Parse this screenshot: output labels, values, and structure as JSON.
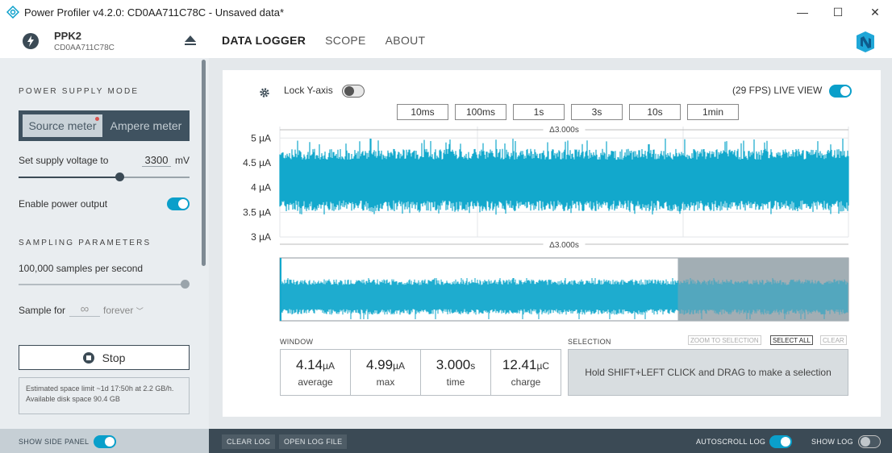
{
  "window": {
    "title": "Power Profiler v4.2.0: CD0AA711C78C - Unsaved data*",
    "minimize": "—",
    "maximize": "☐",
    "close": "✕"
  },
  "device": {
    "name": "PPK2",
    "serial": "CD0AA711C78C"
  },
  "nav": {
    "tabs": [
      "DATA LOGGER",
      "SCOPE",
      "ABOUT"
    ],
    "active": "DATA LOGGER"
  },
  "sidebar": {
    "power_supply_title": "POWER SUPPLY MODE",
    "source_meter": "Source meter",
    "ampere_meter": "Ampere meter",
    "voltage_label": "Set supply voltage to",
    "voltage_value": "3300",
    "voltage_unit": "mV",
    "voltage_fraction": 0.588,
    "power_output_label": "Enable power output",
    "power_output_enabled": true,
    "sampling_title": "SAMPLING PARAMETERS",
    "sample_rate_label": "100,000 samples per second",
    "sample_rate_fraction": 1.0,
    "sample_for_label": "Sample for",
    "sample_for_value": "∞",
    "sample_for_unit": "forever",
    "stop_label": "Stop",
    "space_info": "Estimated space limit ~1d 17:50h at 2.2 GB/h. Available disk space 90.4 GB"
  },
  "toolbar": {
    "lock_y_label": "Lock Y-axis",
    "lock_y_enabled": false,
    "live_view_label": "(29 FPS) LIVE VIEW",
    "live_view_enabled": true,
    "window_buttons": [
      "10ms",
      "100ms",
      "1s",
      "3s",
      "10s",
      "1min"
    ]
  },
  "chart_data": {
    "type": "line",
    "title": "",
    "xlabel": "",
    "ylabel": "",
    "y_unit": "µA",
    "yticks": [
      "5 µA",
      "4.5 µA",
      "4 µA",
      "3.5 µA",
      "3 µA"
    ],
    "ylim": [
      3,
      5.2
    ],
    "duration_label": "Δ3.000s",
    "band": {
      "mean": 4.14,
      "low_typical": 3.65,
      "high_typical": 4.65,
      "min_spike": 3.45,
      "max_spike": 4.99
    },
    "grid": true,
    "minimap_selection_fraction": [
      0.7,
      1.0
    ]
  },
  "window_stats": {
    "title": "WINDOW",
    "items": [
      {
        "value": "4.14",
        "unit": "µA",
        "caption": "average"
      },
      {
        "value": "4.99",
        "unit": "µA",
        "caption": "max"
      },
      {
        "value": "3.000",
        "unit": "s",
        "caption": "time"
      },
      {
        "value": "12.41",
        "unit": "µC",
        "caption": "charge"
      }
    ]
  },
  "selection": {
    "title": "SELECTION",
    "zoom_to_selection": "ZOOM TO SELECTION",
    "select_all": "SELECT ALL",
    "clear": "CLEAR",
    "hint": "Hold SHIFT+LEFT CLICK and DRAG to make a selection"
  },
  "footer": {
    "show_side_panel": "SHOW SIDE PANEL",
    "show_side_panel_enabled": true,
    "clear_log": "CLEAR LOG",
    "open_log_file": "OPEN LOG FILE",
    "autoscroll_log": "AUTOSCROLL LOG",
    "autoscroll_enabled": true,
    "show_log": "SHOW LOG",
    "show_log_enabled": false
  },
  "colors": {
    "accent": "#0a9fca",
    "signal": "#12a8cc",
    "dark": "#3b4a55"
  }
}
